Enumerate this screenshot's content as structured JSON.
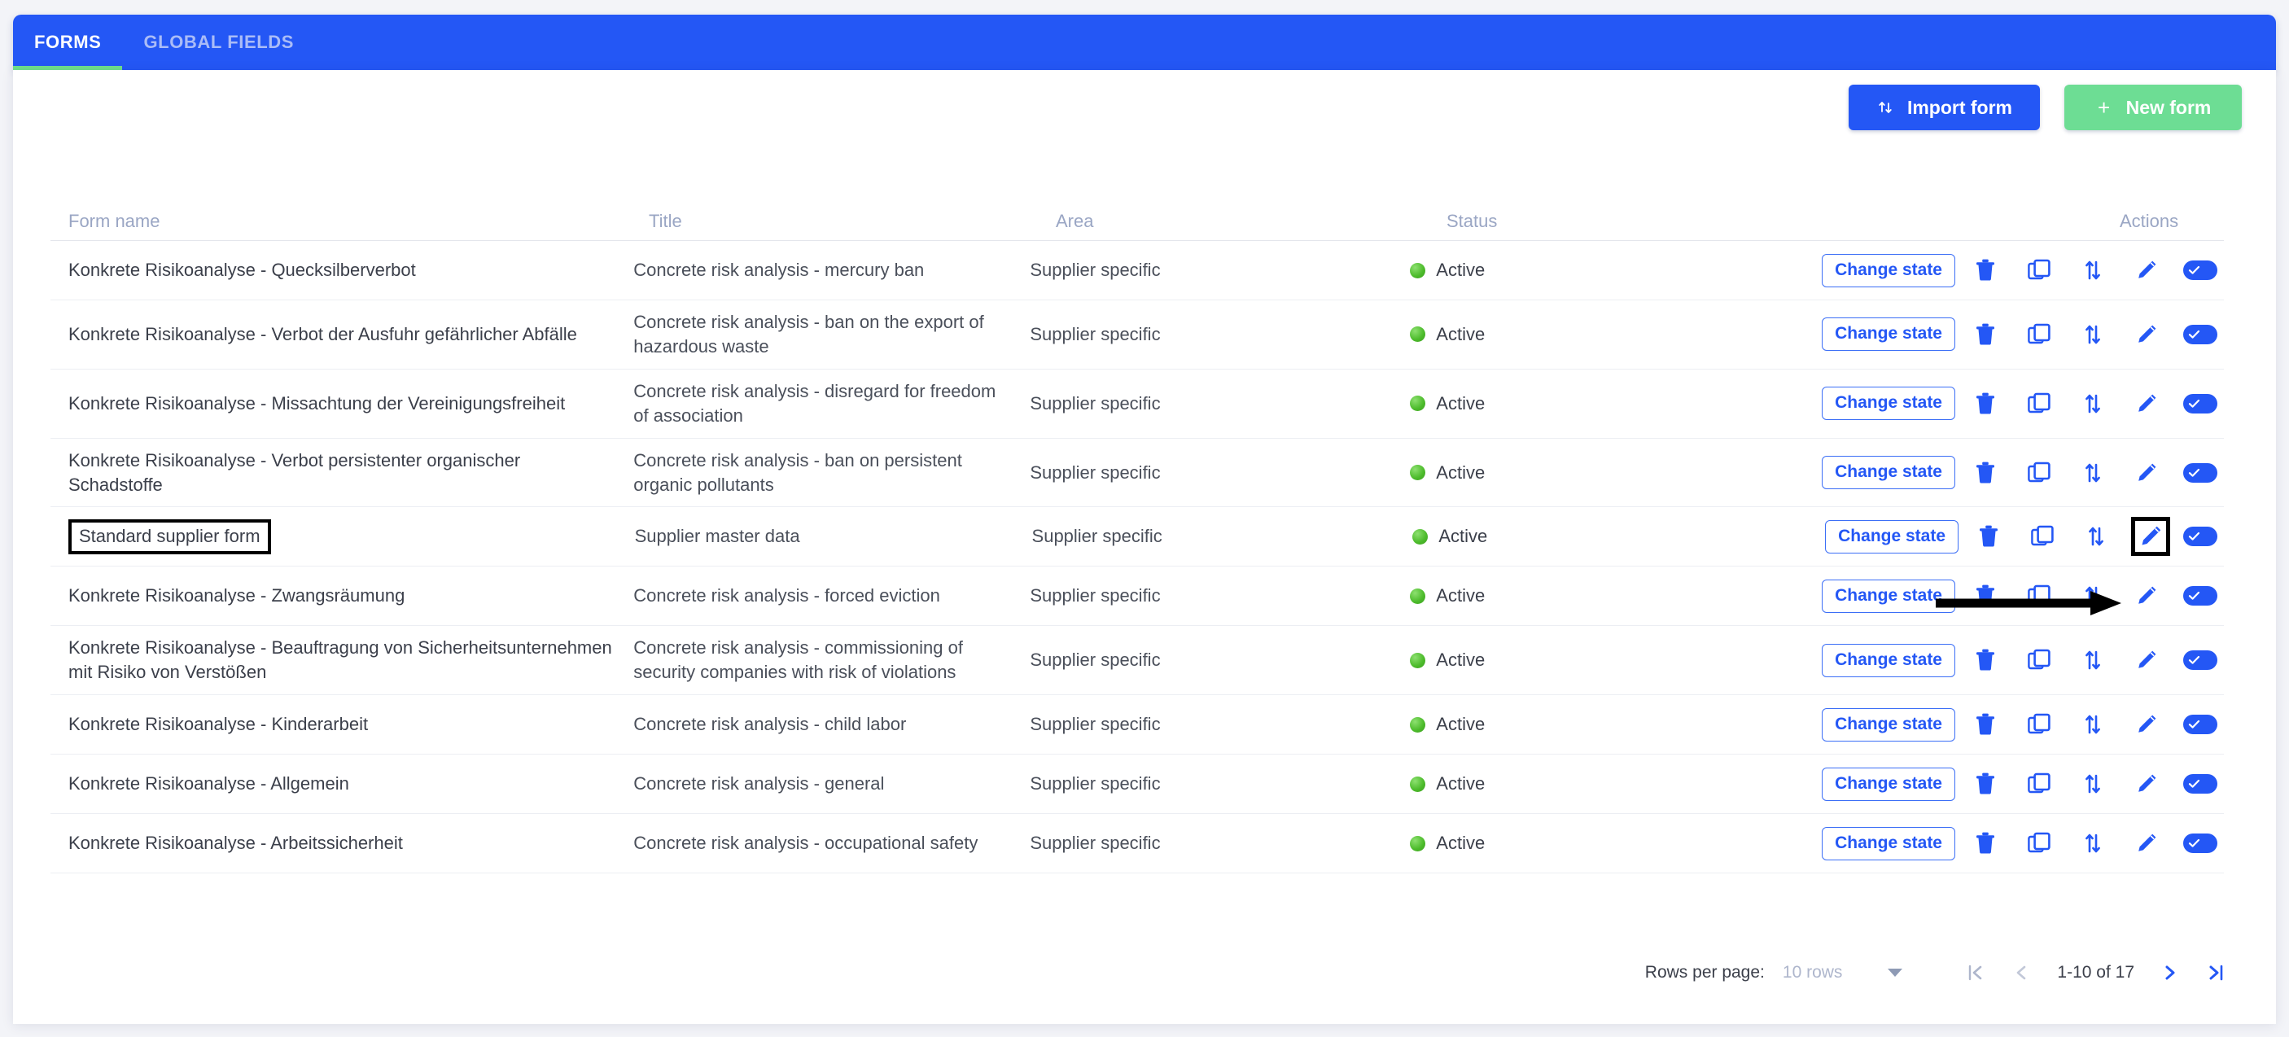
{
  "tabs": [
    {
      "label": "FORMS",
      "active": true
    },
    {
      "label": "GLOBAL FIELDS",
      "active": false
    }
  ],
  "toolbar": {
    "import_label": "Import form",
    "import_icon": "import-arrows-icon",
    "new_label": "New form",
    "new_icon": "plus-icon",
    "import_color": "#2457f5",
    "new_color": "#6ddd94"
  },
  "table": {
    "headers": [
      "Form name",
      "Title",
      "Area",
      "Status",
      "Actions"
    ],
    "row_action_labels": {
      "change_state": "Change state",
      "delete": "delete-icon",
      "copy": "copy-icon",
      "move": "move-updown-icon",
      "edit": "edit-pencil-icon",
      "toggle": "toggle-on-icon"
    },
    "rows": [
      {
        "name": "Konkrete Risikoanalyse - Quecksilberverbot",
        "title": "Concrete risk analysis - mercury ban",
        "area": "Supplier specific",
        "status": "Active",
        "highlighted": false
      },
      {
        "name": "Konkrete Risikoanalyse - Verbot der Ausfuhr gefährlicher Abfälle",
        "title": "Concrete risk analysis - ban on the export of hazardous waste",
        "area": "Supplier specific",
        "status": "Active",
        "highlighted": false
      },
      {
        "name": "Konkrete Risikoanalyse - Missachtung der Vereinigungsfreiheit",
        "title": "Concrete risk analysis - disregard for freedom of association",
        "area": "Supplier specific",
        "status": "Active",
        "highlighted": false
      },
      {
        "name": "Konkrete Risikoanalyse - Verbot persistenter organischer Schadstoffe",
        "title": "Concrete risk analysis - ban on persistent organic pollutants",
        "area": "Supplier specific",
        "status": "Active",
        "highlighted": false
      },
      {
        "name": "Standard supplier form",
        "title": "Supplier master data",
        "area": "Supplier specific",
        "status": "Active",
        "highlighted": true
      },
      {
        "name": "Konkrete Risikoanalyse - Zwangsräumung",
        "title": "Concrete risk analysis - forced eviction",
        "area": "Supplier specific",
        "status": "Active",
        "highlighted": false
      },
      {
        "name": "Konkrete Risikoanalyse - Beauftragung von Sicherheitsunternehmen mit Risiko von Verstößen",
        "title": "Concrete risk analysis - commissioning of security companies with risk of violations",
        "area": "Supplier specific",
        "status": "Active",
        "highlighted": false
      },
      {
        "name": "Konkrete Risikoanalyse - Kinderarbeit",
        "title": "Concrete risk analysis - child labor",
        "area": "Supplier specific",
        "status": "Active",
        "highlighted": false
      },
      {
        "name": "Konkrete Risikoanalyse - Allgemein",
        "title": "Concrete risk analysis - general",
        "area": "Supplier specific",
        "status": "Active",
        "highlighted": false
      },
      {
        "name": "Konkrete Risikoanalyse - Arbeitssicherheit",
        "title": "Concrete risk analysis - occupational safety",
        "area": "Supplier specific",
        "status": "Active",
        "highlighted": false
      }
    ]
  },
  "pagination": {
    "rows_per_page_label": "Rows per page:",
    "rows_per_page_value": "10 rows",
    "range": "1-10 of 17",
    "first_icon": "first-page-icon",
    "prev_icon": "prev-page-icon",
    "next_icon": "next-page-icon",
    "last_icon": "last-page-icon"
  },
  "annotation": {
    "arrow": "pointer-arrow-to-edit-icon"
  },
  "colors": {
    "brand_blue": "#2457f5",
    "accent_green": "#6fe08a",
    "status_green": "#4cbb2b",
    "header_text": "#9aa6c4"
  }
}
